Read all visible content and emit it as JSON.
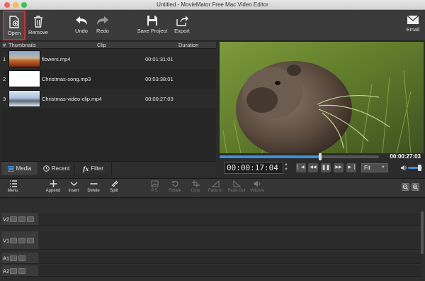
{
  "window": {
    "title": "Untitled - MovieMator Free Mac Video Editor",
    "traffic_colors": [
      "#fc615d",
      "#fdbc40",
      "#34c84a"
    ]
  },
  "toolbar": {
    "open": "Open",
    "remove": "Remove",
    "undo": "Undo",
    "redo": "Redo",
    "save_project": "Save Project",
    "export": "Export",
    "email": "Email"
  },
  "clips": {
    "headers": {
      "num": "#",
      "thumbnails": "Thumbnails",
      "clip": "Clip",
      "duration": "Duration"
    },
    "rows": [
      {
        "num": "1",
        "name": "flowers.mp4",
        "duration": "00:01:31:01",
        "thumb_color": "#c36a2a"
      },
      {
        "num": "2",
        "name": "Christmas-song.mp3",
        "duration": "00:03:38:01",
        "thumb_color": "#ffffff"
      },
      {
        "num": "3",
        "name": "Christmas-video-clip.mp4",
        "duration": "00:00:27:03",
        "thumb_color": "#8fb2d0"
      }
    ]
  },
  "media_tabs": {
    "media": "Media",
    "recent": "Recent",
    "filter": "Filter"
  },
  "player": {
    "total_time": "00:00:27:03",
    "timecode": "00:00:17:04",
    "progress": 0.63,
    "zoom": "Fit",
    "volume": 0.75
  },
  "timeline_toolbar": {
    "menu": "Menu",
    "append": "Append",
    "insert": "Insert",
    "delete": "Delete",
    "split": "Split",
    "ps": "P.S",
    "rotate": "Rotate",
    "crop": "Crop",
    "fade_in": "Fade In",
    "fade_out": "Fade Out",
    "volume": "Volume"
  },
  "tracks": [
    {
      "name": "V2"
    },
    {
      "name": "V1"
    },
    {
      "name": "A1"
    },
    {
      "name": "A2"
    }
  ],
  "colors": {
    "accent": "#3d8fd6",
    "highlight_border": "#d0302a"
  }
}
